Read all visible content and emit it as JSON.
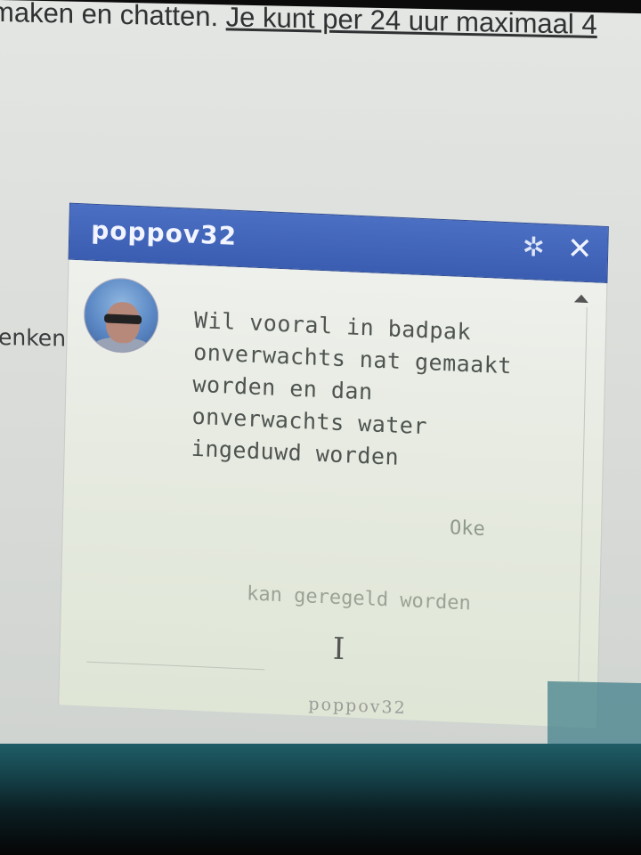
{
  "page": {
    "top_text_plain": "maken en chatten. ",
    "top_text_link": "Je kunt per 24 uur maximaal 4",
    "side_word": "enken"
  },
  "chat": {
    "title": "poppov32",
    "gear_glyph": "✲",
    "close_glyph": "✕",
    "message": "Wil vooral in badpak onverwachts nat gemaakt worden en dan onverwachts water ingeduwd worden",
    "replies": [
      "Oke",
      "kan geregeld worden"
    ],
    "cursor_glyph": "I",
    "footer_name": "poppov32"
  },
  "colors": {
    "header_blue": "#3a5db1",
    "title_text": "#f2f5ff"
  }
}
